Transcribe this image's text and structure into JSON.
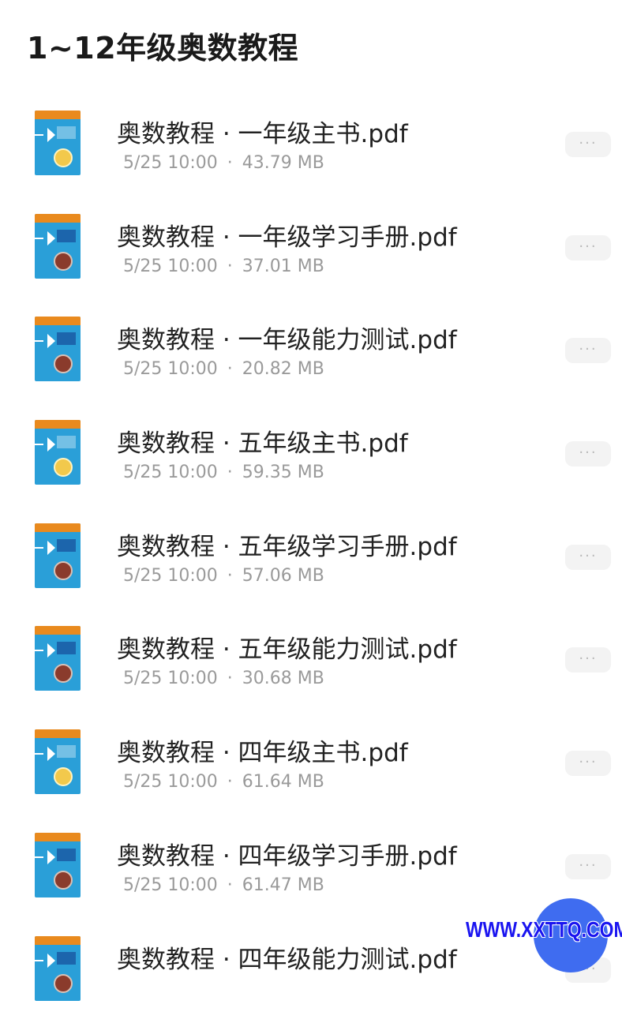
{
  "header": {
    "title": "1~12年级奥数教程"
  },
  "files": [
    {
      "name": "奥数教程 · 一年级主书.pdf",
      "date": "5/25 10:00",
      "size": "43.79 MB",
      "thumb": "book",
      "more_label": "···"
    },
    {
      "name": "奥数教程 · 一年级学习手册.pdf",
      "date": "5/25 10:00",
      "size": "37.01 MB",
      "thumb": "manual",
      "more_label": "···"
    },
    {
      "name": "奥数教程 · 一年级能力测试.pdf",
      "date": "5/25 10:00",
      "size": "20.82 MB",
      "thumb": "test",
      "more_label": "···"
    },
    {
      "name": "奥数教程 · 五年级主书.pdf",
      "date": "5/25 10:00",
      "size": "59.35 MB",
      "thumb": "book",
      "more_label": "···"
    },
    {
      "name": "奥数教程 · 五年级学习手册.pdf",
      "date": "5/25 10:00",
      "size": "57.06 MB",
      "thumb": "manual",
      "more_label": "···"
    },
    {
      "name": "奥数教程 · 五年级能力测试.pdf",
      "date": "5/25 10:00",
      "size": "30.68 MB",
      "thumb": "test",
      "more_label": "···"
    },
    {
      "name": "奥数教程 · 四年级主书.pdf",
      "date": "5/25 10:00",
      "size": "61.64 MB",
      "thumb": "book",
      "more_label": "···"
    },
    {
      "name": "奥数教程 · 四年级学习手册.pdf",
      "date": "5/25 10:00",
      "size": "61.47 MB",
      "thumb": "manual",
      "more_label": "···"
    },
    {
      "name": "奥数教程 · 四年级能力测试.pdf",
      "date": "",
      "size": "",
      "thumb": "test",
      "more_label": "···"
    }
  ],
  "meta_separator": "·",
  "watermark": "WWW.XXTTQ.COM",
  "colors": {
    "accent": "#3f6cf0",
    "watermark": "#1a14f0",
    "thumb_blue": "#2a9fd8",
    "thumb_orange": "#e98a1e"
  }
}
